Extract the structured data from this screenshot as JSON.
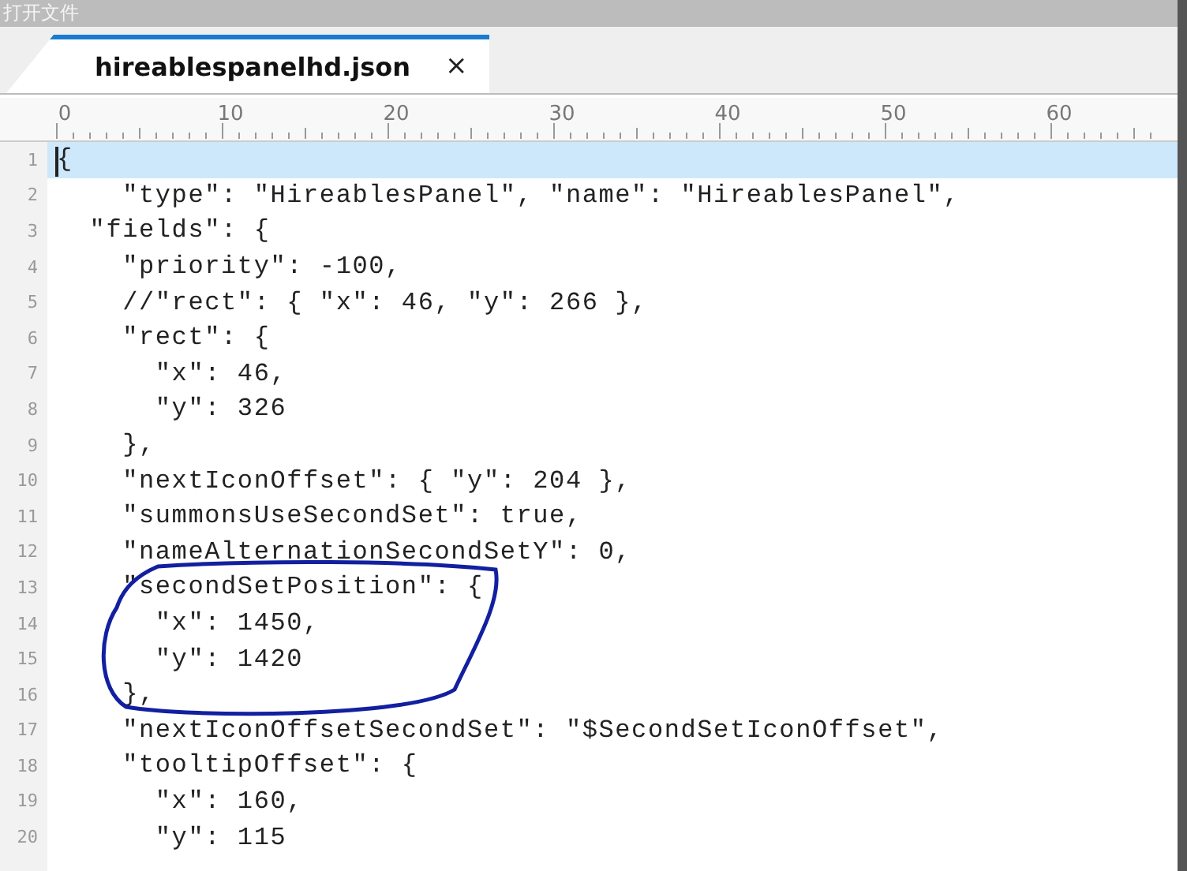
{
  "window": {
    "title": "打开文件"
  },
  "tabs": [
    {
      "label": "hireablespanelhd.json",
      "selected": true,
      "close": "×"
    }
  ],
  "ruler": {
    "labels": [
      "0",
      "10",
      "20",
      "30",
      "40",
      "50",
      "60"
    ]
  },
  "editor": {
    "lines": [
      {
        "number": "1",
        "text": "{",
        "current": true
      },
      {
        "number": "2",
        "text": "    \"type\": \"HireablesPanel\", \"name\": \"HireablesPanel\",",
        "current": false
      },
      {
        "number": "3",
        "text": "  \"fields\": {",
        "current": false
      },
      {
        "number": "4",
        "text": "    \"priority\": -100,",
        "current": false
      },
      {
        "number": "5",
        "text": "    //\"rect\": { \"x\": 46, \"y\": 266 },",
        "current": false
      },
      {
        "number": "6",
        "text": "    \"rect\": {",
        "current": false
      },
      {
        "number": "7",
        "text": "      \"x\": 46,",
        "current": false
      },
      {
        "number": "8",
        "text": "      \"y\": 326",
        "current": false
      },
      {
        "number": "9",
        "text": "    },",
        "current": false
      },
      {
        "number": "10",
        "text": "    \"nextIconOffset\": { \"y\": 204 },",
        "current": false
      },
      {
        "number": "11",
        "text": "    \"summonsUseSecondSet\": true,",
        "current": false
      },
      {
        "number": "12",
        "text": "    \"nameAlternationSecondSetY\": 0,",
        "current": false
      },
      {
        "number": "13",
        "text": "    \"secondSetPosition\": {",
        "current": false
      },
      {
        "number": "14",
        "text": "      \"x\": 1450,",
        "current": false
      },
      {
        "number": "15",
        "text": "      \"y\": 1420",
        "current": false
      },
      {
        "number": "16",
        "text": "    },",
        "current": false
      },
      {
        "number": "17",
        "text": "    \"nextIconOffsetSecondSet\": \"$SecondSetIconOffset\",",
        "current": false
      },
      {
        "number": "18",
        "text": "    \"tooltipOffset\": {",
        "current": false
      },
      {
        "number": "19",
        "text": "      \"x\": 160,",
        "current": false
      },
      {
        "number": "20",
        "text": "      \"y\": 115",
        "current": false
      }
    ]
  }
}
